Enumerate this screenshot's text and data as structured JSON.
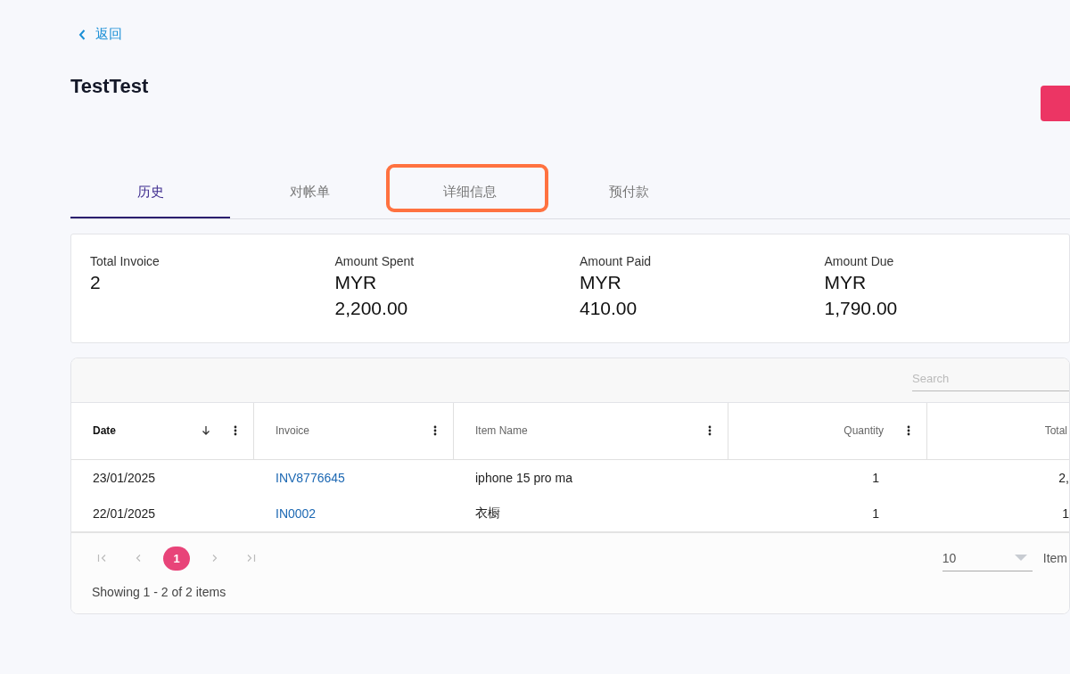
{
  "back_link": "返回",
  "title": "TestTest",
  "tabs": [
    {
      "label": "历史",
      "selected": true,
      "highlighted": false
    },
    {
      "label": "对帐单",
      "selected": false,
      "highlighted": false
    },
    {
      "label": "详细信息",
      "selected": false,
      "highlighted": true
    },
    {
      "label": "预付款",
      "selected": false,
      "highlighted": false
    }
  ],
  "summary": [
    {
      "label": "Total Invoice",
      "value": "2"
    },
    {
      "label": "Amount Spent",
      "value": "MYR\n2,200.00"
    },
    {
      "label": "Amount Paid",
      "value": "MYR\n410.00"
    },
    {
      "label": "Amount Due",
      "value": "MYR\n1,790.00"
    }
  ],
  "search": {
    "placeholder": "Search"
  },
  "table": {
    "columns": [
      {
        "label": "Date",
        "kind": "text",
        "sorted": true,
        "menu": true
      },
      {
        "label": "Invoice",
        "kind": "text",
        "sorted": false,
        "menu": true
      },
      {
        "label": "Item Name",
        "kind": "text",
        "sorted": false,
        "menu": true
      },
      {
        "label": "Quantity",
        "kind": "number",
        "sorted": false,
        "menu": true
      },
      {
        "label": "Total",
        "kind": "number",
        "sorted": false,
        "menu": false
      }
    ],
    "rows": [
      {
        "cells": [
          "23/01/2025",
          "INV8776645",
          "iphone 15 pro ma",
          "1",
          "2,"
        ]
      },
      {
        "cells": [
          "22/01/2025",
          "IN0002",
          "衣橱",
          "1",
          "1"
        ]
      }
    ]
  },
  "pager": {
    "pages": [
      {
        "label": "1",
        "selected": true
      }
    ],
    "page_size": "10",
    "page_size_label": "Item",
    "summary": "Showing 1 - 2 of 2 items"
  }
}
